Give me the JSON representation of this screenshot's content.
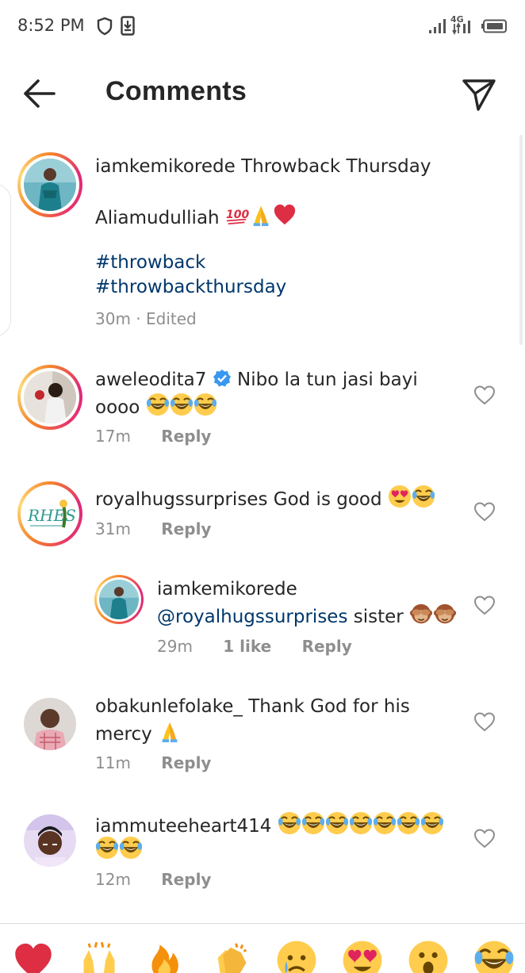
{
  "status_bar": {
    "time": "8:52 PM",
    "network": "4G"
  },
  "header": {
    "title": "Comments"
  },
  "caption": {
    "username": "iamkemikorede",
    "line1": "Throwback Thursday",
    "line2": "Aliamudulliah",
    "hashtags": [
      "#throwback",
      "#throwbackthursday"
    ],
    "time": "30m",
    "edited": "· Edited"
  },
  "comments": [
    {
      "username": "aweleodita7",
      "verified": true,
      "text_line1": "Nibo la tun jasi bayi",
      "text_line2": "oooo",
      "time": "17m",
      "reply": "Reply"
    },
    {
      "username": "royalhugssurprises",
      "text": "God is good",
      "time": "31m",
      "reply": "Reply",
      "avatar_text": "RHES"
    },
    {
      "username": "iamkemikorede",
      "mention": "@royalhugssurprises",
      "text": "sister",
      "time": "29m",
      "likes": "1 like",
      "reply": "Reply"
    },
    {
      "username": "obakunlefolake_",
      "text_line1": "Thank God for his",
      "text_line2": "mercy",
      "time": "11m",
      "reply": "Reply"
    },
    {
      "username": "iammuteeheart414",
      "time": "12m",
      "reply": "Reply"
    }
  ],
  "emoji_bar": [
    "heart",
    "raising-hands",
    "fire",
    "clapping-hands",
    "crying-face",
    "heart-eyes",
    "surprised-face",
    "tears-of-joy"
  ],
  "colors": {
    "text": "#262626",
    "meta": "#8e8e8e",
    "link": "#00376b",
    "verified": "#3897f0"
  }
}
